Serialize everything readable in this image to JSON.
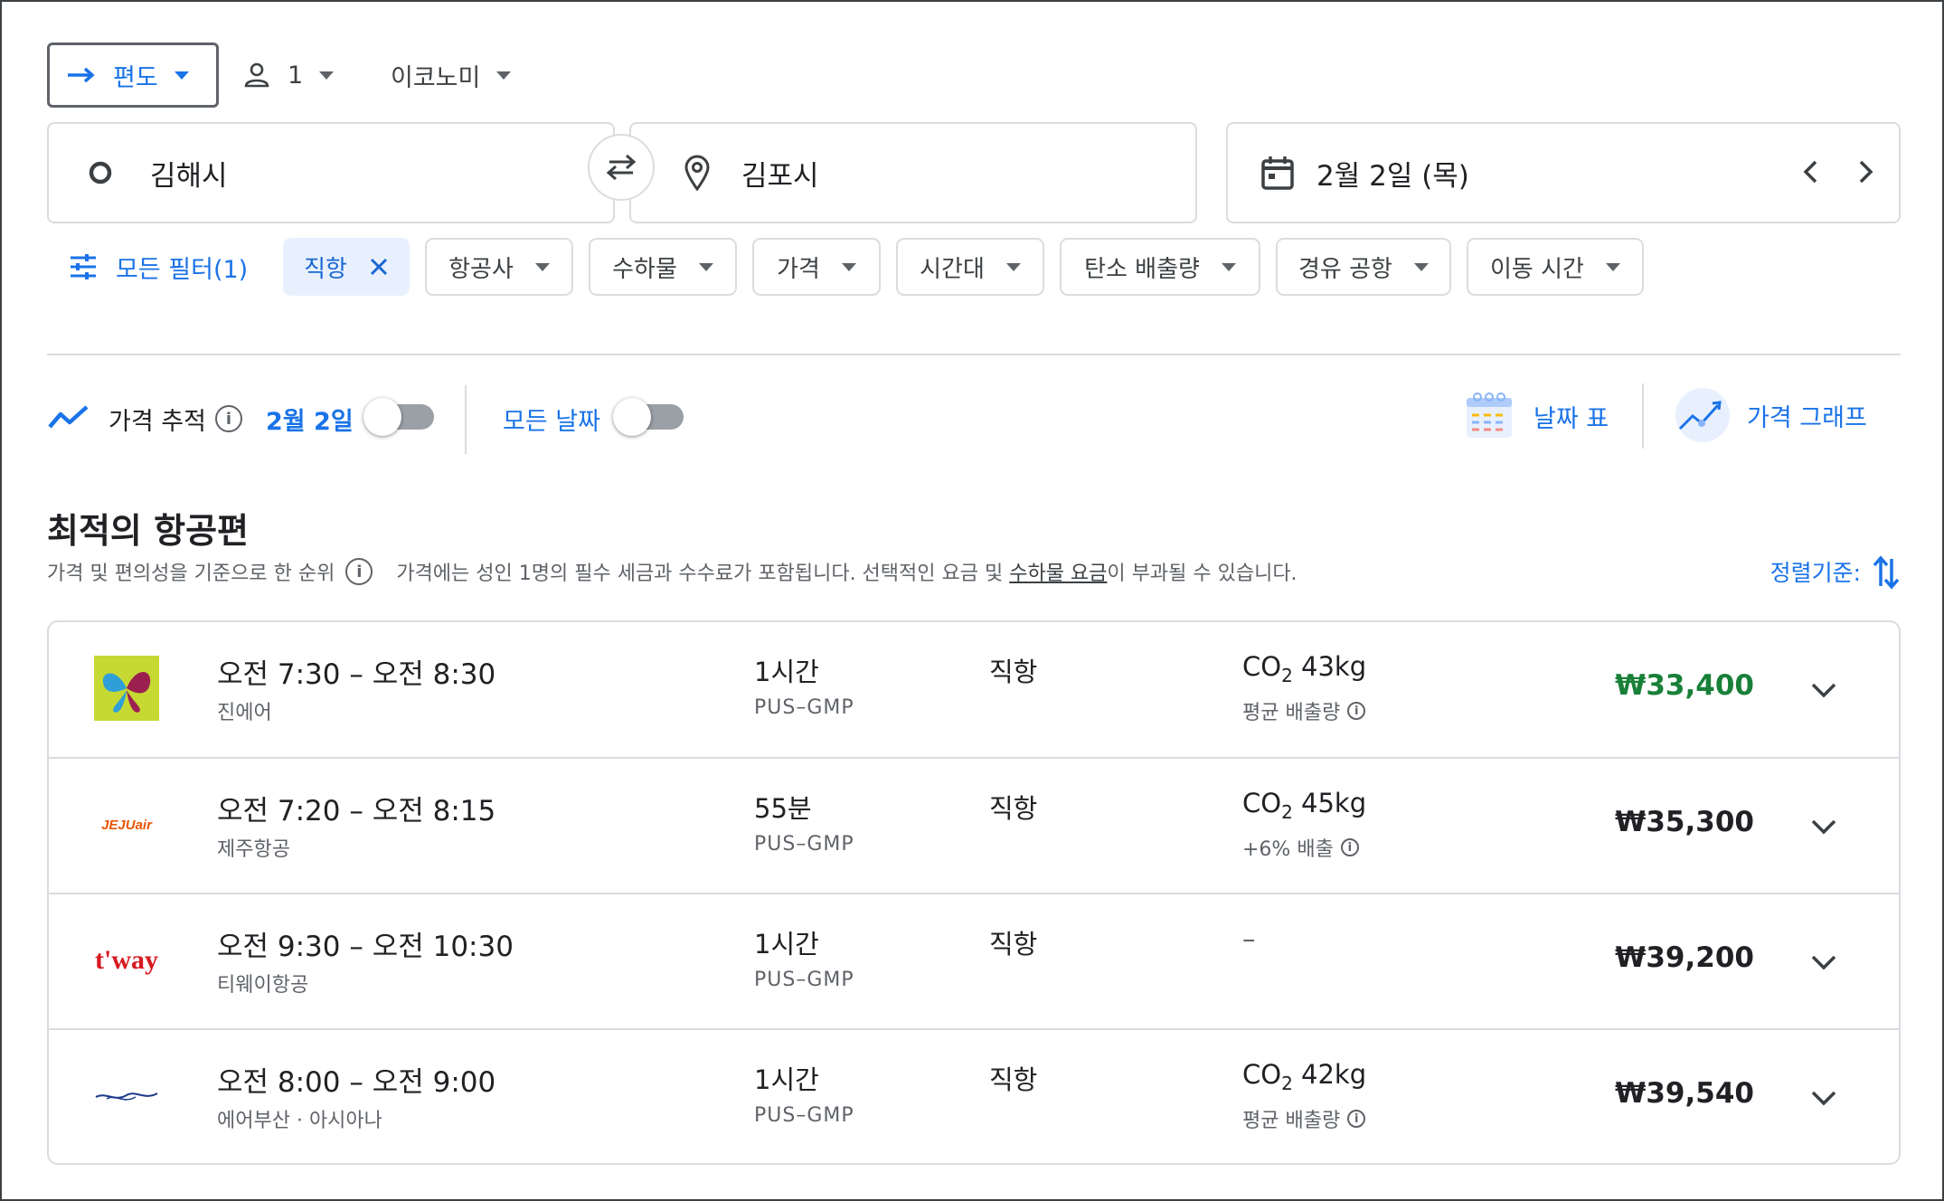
{
  "trip": {
    "type_label": "편도",
    "passengers": "1",
    "cabin": "이코노미"
  },
  "search": {
    "origin": "김해시",
    "destination": "김포시",
    "date": "2월 2일 (목)"
  },
  "filters": {
    "all_filters": "모든 필터(1)",
    "chips": [
      "직항",
      "항공사",
      "수하물",
      "가격",
      "시간대",
      "탄소 배출량",
      "경유 공항",
      "이동 시간"
    ]
  },
  "tracking": {
    "label": "가격 추적",
    "date_label": "2월 2일",
    "all_dates_label": "모든 날짜",
    "date_grid_label": "날짜 표",
    "price_graph_label": "가격 그래프"
  },
  "results": {
    "title": "최적의 항공편",
    "subtitle": "가격 및 편의성을 기준으로 한 순위",
    "notice_part1": "가격에는 성인 1명의 필수 세금과 수수료가 포함됩니다. 선택적인 요금 및 ",
    "notice_link": "수하물 요금",
    "notice_part2": "이 부과될 수 있습니다.",
    "sort_label": "정렬기준:",
    "flights": [
      {
        "times": "오전 7:30 – 오전 8:30",
        "airline": "진에어",
        "duration": "1시간",
        "route": "PUS–GMP",
        "stops": "직항",
        "co2_prefix": "CO",
        "co2_sub": "2",
        "co2_value": " 43kg",
        "co2_note": "평균 배출량",
        "price": "₩33,400"
      },
      {
        "times": "오전 7:20 – 오전 8:15",
        "airline": "제주항공",
        "duration": "55분",
        "route": "PUS–GMP",
        "stops": "직항",
        "co2_prefix": "CO",
        "co2_sub": "2",
        "co2_value": " 45kg",
        "co2_note": "+6% 배출",
        "price": "₩35,300",
        "logo_text": "JEJUair"
      },
      {
        "times": "오전 9:30 – 오전 10:30",
        "airline": "티웨이항공",
        "duration": "1시간",
        "route": "PUS–GMP",
        "stops": "직항",
        "co2_none": "–",
        "price": "₩39,200",
        "logo_text": "t'way"
      },
      {
        "times": "오전 8:00 – 오전 9:00",
        "airline": "에어부산 · 아시아나",
        "duration": "1시간",
        "route": "PUS–GMP",
        "stops": "직항",
        "co2_prefix": "CO",
        "co2_sub": "2",
        "co2_value": " 42kg",
        "co2_note": "평균 배출량",
        "price": "₩39,540"
      }
    ]
  },
  "colors": {
    "accent": "#1a73e8",
    "price_best": "#188038",
    "chip_active_bg": "#e8f0fe"
  }
}
